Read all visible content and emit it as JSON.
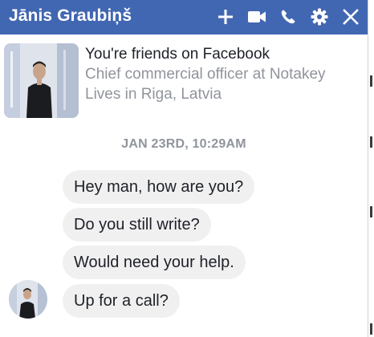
{
  "header": {
    "title": "Jānis Graubiņš",
    "icons": [
      "add-icon",
      "video-camera-icon",
      "phone-icon",
      "gear-icon",
      "close-icon"
    ],
    "background": "#4267b2"
  },
  "profile": {
    "line1": "You're friends on Facebook",
    "line2": "Chief commercial officer at Notakey",
    "line3": "Lives in Riga, Latvia"
  },
  "conversation": {
    "timestamp": "JAN 23RD, 10:29AM",
    "messages": [
      "Hey man, how are you?",
      "Do you still write?",
      "Would need your help.",
      "Up for a call?"
    ]
  }
}
